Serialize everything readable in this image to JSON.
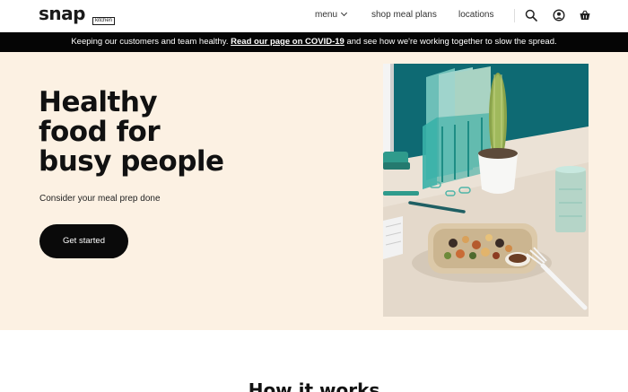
{
  "header": {
    "logo_text": "snap",
    "logo_sub": "kitchen",
    "nav": {
      "menu": "menu",
      "shop": "shop meal plans",
      "locations": "locations"
    },
    "icons": [
      "search-icon",
      "account-icon",
      "cart-icon"
    ]
  },
  "banner": {
    "pre": "Keeping our customers and team healthy. ",
    "link": "Read our page on COVID-19",
    "post": " and see how we're working together to slow the spread."
  },
  "hero": {
    "title_line1": "Healthy",
    "title_line2": "food for",
    "title_line3": "busy people",
    "subtitle": "Consider your meal prep done",
    "cta": "Get started"
  },
  "section": {
    "title": "How it works"
  },
  "colors": {
    "hero_bg": "#fcf1e3",
    "banner_bg": "#050505",
    "button_bg": "#0a0a0a",
    "image_wall": "#0e6a73"
  }
}
